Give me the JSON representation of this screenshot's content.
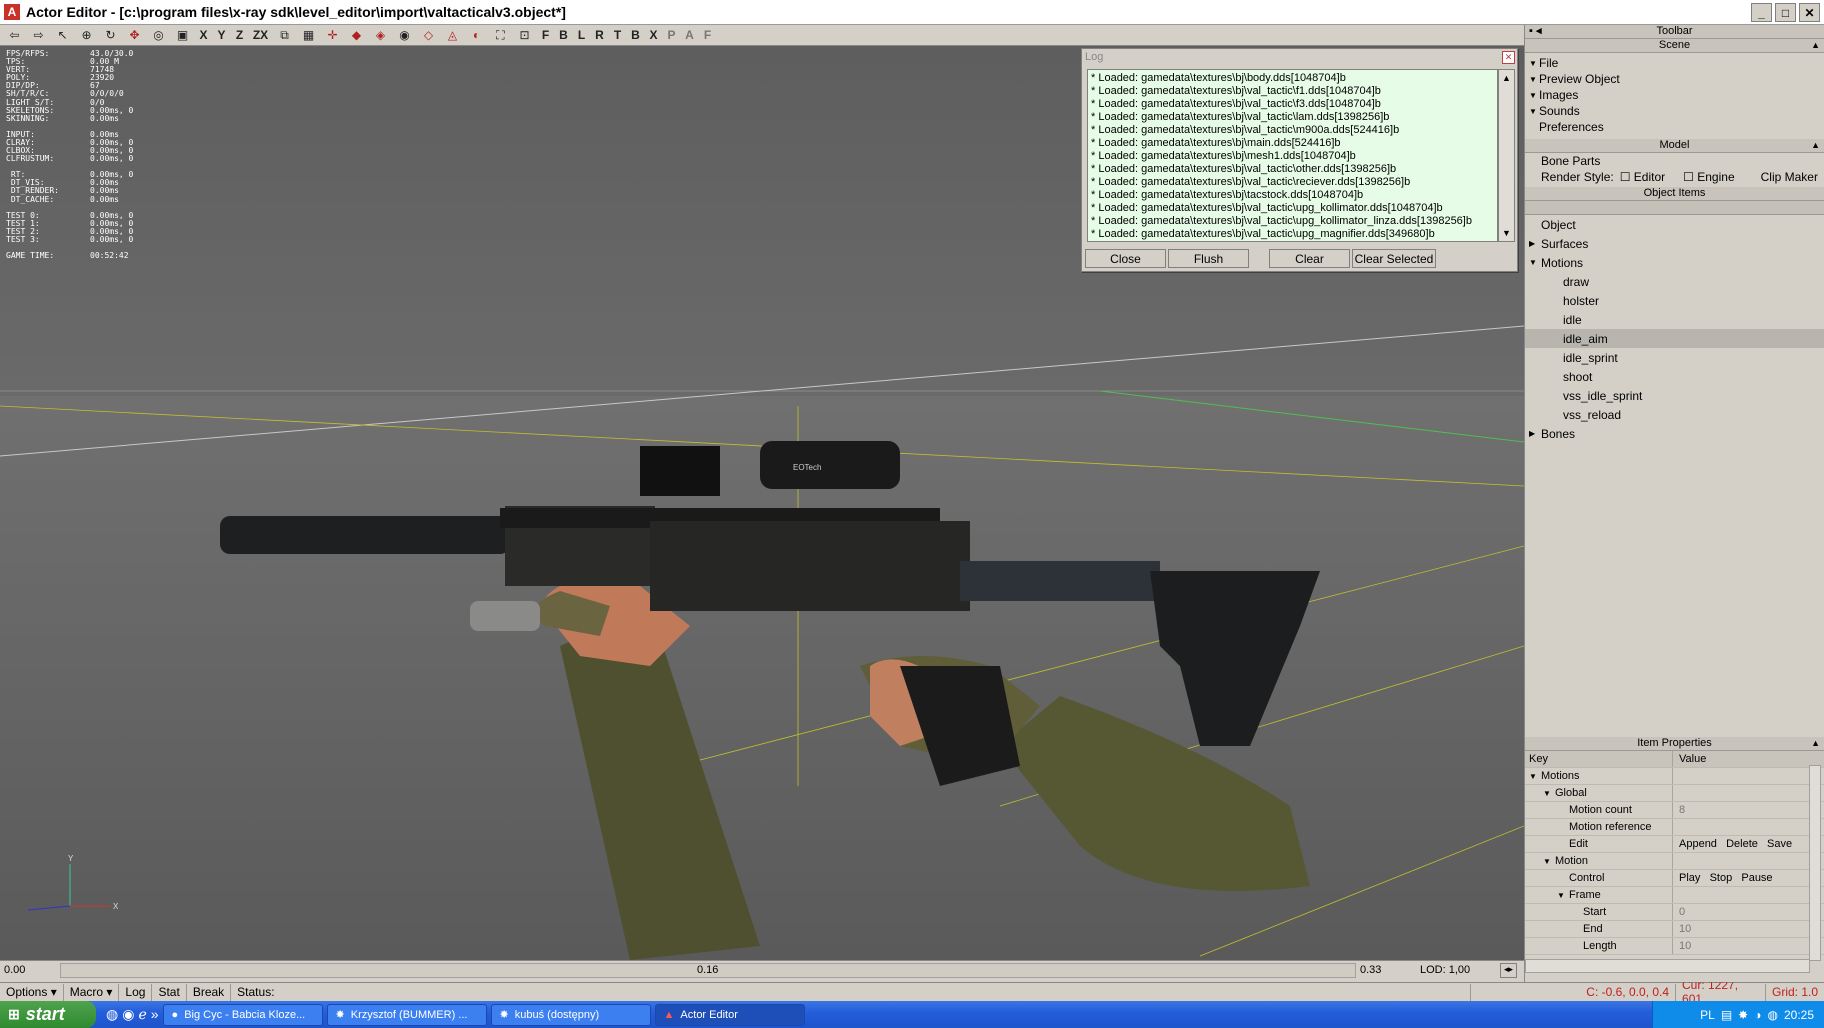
{
  "window": {
    "title": "Actor Editor - [c:\\program files\\x-ray sdk\\level_editor\\import\\valtacticalv3.object*]"
  },
  "toolbar": {
    "letters": [
      "X",
      "Y",
      "Z",
      "ZX",
      "F",
      "B",
      "L",
      "R",
      "T",
      "B",
      "X",
      "P",
      "A",
      "F"
    ]
  },
  "stats": [
    {
      "k": "FPS/RFPS:",
      "v": "43.0/30.0"
    },
    {
      "k": "TPS:",
      "v": "0.00 M"
    },
    {
      "k": "VERT:",
      "v": "71748"
    },
    {
      "k": "POLY:",
      "v": "23920"
    },
    {
      "k": "DIP/DP:",
      "v": "67"
    },
    {
      "k": "SH/T/R/C:",
      "v": "0/0/0/0"
    },
    {
      "k": "LIGHT S/T:",
      "v": "0/0"
    },
    {
      "k": "SKELETONS:",
      "v": "0.00ms, 0"
    },
    {
      "k": "SKINNING:",
      "v": "0.00ms"
    },
    {
      "k": "",
      "v": ""
    },
    {
      "k": "INPUT:",
      "v": "0.00ms"
    },
    {
      "k": "CLRAY:",
      "v": "0.00ms, 0"
    },
    {
      "k": "CLBOX:",
      "v": "0.00ms, 0"
    },
    {
      "k": "CLFRUSTUM:",
      "v": "0.00ms, 0"
    },
    {
      "k": "",
      "v": ""
    },
    {
      "k": " RT:",
      "v": "0.00ms, 0"
    },
    {
      "k": " DT_VIS:",
      "v": "0.00ms"
    },
    {
      "k": " DT_RENDER:",
      "v": "0.00ms"
    },
    {
      "k": " DT_CACHE:",
      "v": "0.00ms"
    },
    {
      "k": "",
      "v": ""
    },
    {
      "k": "TEST 0:",
      "v": "0.00ms, 0"
    },
    {
      "k": "TEST 1:",
      "v": "0.00ms, 0"
    },
    {
      "k": "TEST 2:",
      "v": "0.00ms, 0"
    },
    {
      "k": "TEST 3:",
      "v": "0.00ms, 0"
    },
    {
      "k": "",
      "v": ""
    },
    {
      "k": "GAME TIME:",
      "v": "00:52:42"
    }
  ],
  "log": {
    "title": "Log",
    "lines": [
      "* Loaded: gamedata\\textures\\bj\\body.dds[1048704]b",
      "* Loaded: gamedata\\textures\\bj\\val_tactic\\f1.dds[1048704]b",
      "* Loaded: gamedata\\textures\\bj\\val_tactic\\f3.dds[1048704]b",
      "* Loaded: gamedata\\textures\\bj\\val_tactic\\lam.dds[1398256]b",
      "* Loaded: gamedata\\textures\\bj\\val_tactic\\m900a.dds[524416]b",
      "* Loaded: gamedata\\textures\\bj\\main.dds[524416]b",
      "* Loaded: gamedata\\textures\\bj\\mesh1.dds[1048704]b",
      "* Loaded: gamedata\\textures\\bj\\val_tactic\\other.dds[1398256]b",
      "* Loaded: gamedata\\textures\\bj\\val_tactic\\reciever.dds[1398256]b",
      "* Loaded: gamedata\\textures\\bj\\tacstock.dds[1048704]b",
      "* Loaded: gamedata\\textures\\bj\\val_tactic\\upg_kollimator.dds[1048704]b",
      "* Loaded: gamedata\\textures\\bj\\val_tactic\\upg_kollimator_linza.dds[1398256]b",
      "* Loaded: gamedata\\textures\\bj\\val_tactic\\upg_magnifier.dds[349680]b"
    ],
    "buttons": {
      "close": "Close",
      "flush": "Flush",
      "clear": "Clear",
      "clear_selected": "Clear Selected"
    }
  },
  "timeline": {
    "start": "0.00",
    "current": "0.16",
    "end": "0.33",
    "lod": "LOD: 1,00"
  },
  "statusbar": {
    "options": "Options",
    "macro": "Macro",
    "log": "Log",
    "stat": "Stat",
    "break": "Break",
    "status": "Status:",
    "coords": "C: -0.6, 0.0, 0.4",
    "cursor": "Cur: 1227, 601",
    "grid": "Grid: 1.0"
  },
  "panel": {
    "toolbar_title": "Toolbar",
    "scene_title": "Scene",
    "scene_items": [
      "File",
      "Preview Object",
      "Images",
      "Sounds",
      "Preferences"
    ],
    "model_title": "Model",
    "bone_parts": "Bone Parts",
    "render_style": "Render Style:",
    "editor": "Editor",
    "engine": "Engine",
    "clip_maker": "Clip Maker",
    "object_items_title": "Object Items",
    "tree": {
      "object": "Object",
      "surfaces": "Surfaces",
      "motions": "Motions",
      "bones": "Bones",
      "motion_list": [
        "draw",
        "holster",
        "idle",
        "idle_aim",
        "idle_sprint",
        "shoot",
        "vss_idle_sprint",
        "vss_reload"
      ],
      "selected": "idle_aim"
    },
    "item_props_title": "Item Properties",
    "props": {
      "key_col": "Key",
      "value_col": "Value",
      "rows": [
        {
          "key": "Motions",
          "value": "",
          "indent": 0,
          "caret": true
        },
        {
          "key": "Global",
          "value": "",
          "indent": 1,
          "caret": true
        },
        {
          "key": "Motion count",
          "value": "8",
          "indent": 2
        },
        {
          "key": "Motion reference",
          "value": "",
          "indent": 2
        },
        {
          "key": "Edit",
          "value": "Append   Delete   Save",
          "indent": 2
        },
        {
          "key": "Motion",
          "value": "",
          "indent": 1,
          "caret": true
        },
        {
          "key": "Control",
          "value": "Play   Stop   Pause",
          "indent": 2
        },
        {
          "key": "Frame",
          "value": "",
          "indent": 2,
          "caret": true
        },
        {
          "key": "Start",
          "value": "0",
          "indent": 3
        },
        {
          "key": "End",
          "value": "10",
          "indent": 3
        },
        {
          "key": "Length",
          "value": "10",
          "indent": 3
        }
      ]
    }
  },
  "taskbar": {
    "start": "start",
    "tasks": [
      "Big Cyc - Babcia Kloze...",
      "Krzysztof (BUMMER) ...",
      "kubuś (dostępny)",
      "Actor Editor"
    ],
    "lang": "PL",
    "clock": "20:25"
  },
  "scene": {
    "scope_brand": "EOTech",
    "axis_y": "Y",
    "axis_x": "X"
  }
}
